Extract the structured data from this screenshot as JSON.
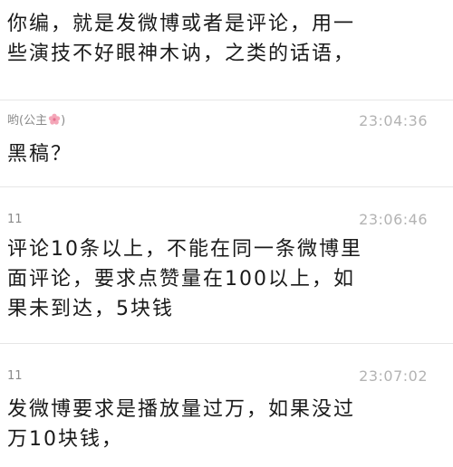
{
  "messages": [
    {
      "sender": "",
      "time": "",
      "text": "你编，就是发微博或者是评论，用一\n些演技不好眼神木讷，之类的话语，"
    },
    {
      "sender": "哟(公主",
      "sender_icon": "cherry-blossom-icon",
      "time": "23:04:36",
      "text": "黑稿？"
    },
    {
      "sender": "11",
      "time": "23:06:46",
      "text": "评论10条以上，不能在同一条微博里\n面评论，要求点赞量在100以上，如\n果未到达，5块钱"
    },
    {
      "sender": "11",
      "time": "23:07:02",
      "text": "发微博要求是播放量过万，如果没过\n万10块钱，"
    }
  ],
  "colors": {
    "text": "#1a1a1a",
    "meta": "#8a8a8a",
    "time": "#b3b3b3",
    "divider": "#e6e6e6",
    "flower_pink": "#f4a6b8"
  }
}
